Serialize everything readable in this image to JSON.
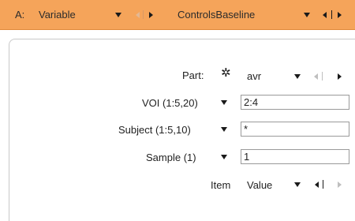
{
  "header": {
    "prefix": "A:",
    "source_value": "Variable",
    "series_value": "ControlsBaseline"
  },
  "form": {
    "part": {
      "label": "Part:",
      "value": "avr",
      "icon": "asterisk-tool-icon"
    },
    "voi": {
      "label": "VOI (1:5,20)",
      "value": "2:4"
    },
    "subject": {
      "label": "Subject (1:5,10)",
      "value": "*"
    },
    "sample": {
      "label": "Sample (1)",
      "value": "1"
    },
    "item": {
      "label": "Item",
      "value": "Value"
    }
  },
  "colors": {
    "header_bg": "#f5a45a",
    "panel_border": "#c9c9c9"
  }
}
